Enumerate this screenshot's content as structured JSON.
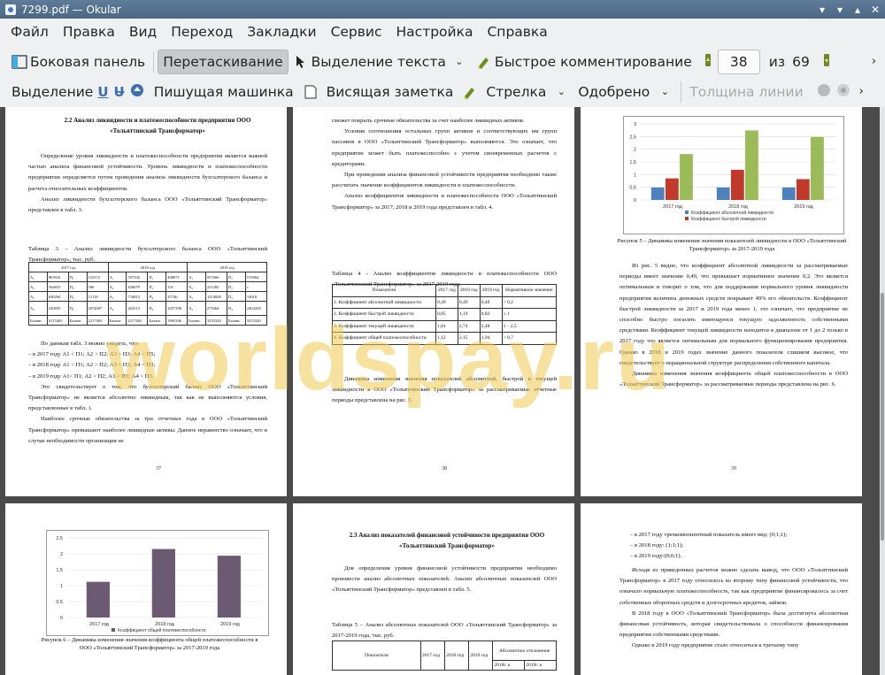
{
  "window": {
    "title": "7299.pdf  — Okular"
  },
  "menu": [
    "Файл",
    "Правка",
    "Вид",
    "Переход",
    "Закладки",
    "Сервис",
    "Настройка",
    "Справка"
  ],
  "toolbar1": {
    "sidebar": "Боковая панель",
    "drag": "Перетаскивание",
    "text_select": "Выделение текста",
    "quick_comment": "Быстрое комментирование",
    "page_current": "38",
    "of": "из",
    "page_total": "69"
  },
  "toolbar2": {
    "select": "Выделение",
    "typewriter": "Пишущая машинка",
    "note": "Висящая заметка",
    "arrow": "Стрелка",
    "stamp": "Одобрено",
    "line_width": "Толщина линии"
  },
  "watermark": "worldspay.ru",
  "p37": {
    "heading": "2.2 Анализ ликвидности и платежеспособности предприятия ООО «Тольяттинский Трансформатор»",
    "para1": "Определение уровня ликвидности и платежеспособности предприятия является важной частью анализа финансовой устойчивости. Уровень ликвидности и платежеспособности предприятия определяется путем проведения анализа ликвидности бухгалтерского баланса и расчета относительных коэффициентов.",
    "para2": "Анализ ликвидности бухгалтерского баланса ООО «Тольяттинский Трансформатор» представлен в табл. 3.",
    "table_caption": "Таблица 3 – Анализ ликвидности бухгалтерского баланса ООО «Тольяттинский Трансформатор», тыс. руб.",
    "years": [
      "2017 год",
      "2018 год",
      "2019 год"
    ],
    "rows": [
      [
        "А₁",
        "863916",
        "П₁",
        "125372",
        "А₁",
        "597556",
        "П₁",
        "408971",
        "А₁",
        "957606",
        "П₁",
        "576964"
      ],
      [
        "А₂",
        "564653",
        "П₂",
        "586",
        "А₂",
        "426079",
        "П₂",
        "331",
        "А₂",
        "231282",
        "П₂",
        "с"
      ],
      [
        "А₃",
        "648264",
        "П₃",
        "12118",
        "А₃",
        "734823",
        "П₃",
        "25746",
        "А₃",
        "1214828",
        "П₃",
        "14618"
      ],
      [
        "А₄",
        "249059",
        "П₄",
        "2074687",
        "А₄",
        "262513",
        "П₄",
        "2057298",
        "А₄",
        "279364",
        "П₄",
        "2464358"
      ],
      [
        "Баланс",
        "4115463",
        "Баланс",
        "2217463",
        "Баланс",
        "2217463",
        "Баланс",
        "3965346",
        "Баланс",
        "3253320",
        "Баланс",
        "3253320"
      ]
    ],
    "para3": "По данным табл. 3 можно увидеть, что:",
    "bullets": [
      "в 2017 году А1 < П1; А2 > П2; А3 > П3; А4 < П5;",
      "в 2018 году А1 < П1; А2 > П2; А3 > П3; А4 < П3;",
      "в 2019 году А1< П1; А2 > П2; А3 > П3; А4 < П3."
    ],
    "para4": "Это свидетельствует о том, что бухгалтерский баланс ООО «Тольяттинский Трансформатор» не является абсолютно ликвидным, так как не выполняются условия, представленные в табл. 1.",
    "para5": "Наиболее срочные обязательства за три отчетных года в ООО «Тольяттинский Трансформатор» превышают наиболее ликвидные активы. Данное неравенство означает, что в случае необходимости организация не",
    "page_number": "37"
  },
  "p38": {
    "para1": "сможет покрыть срочные обязательства за счет наиболее ликвидных активов.",
    "para2": "Условия соотношения остальных групп активов и соответствующих им групп пассивов в ООО «Тольяттинский Трансформатор» выполняются. Это означает, что предприятие может быть платежеспособно с учетом своевременных расчетов с кредиторами.",
    "para3": "При проведении анализа финансовой устойчивости предприятия необходимо также рассчитать значение коэффициентов ликвидности и платежеспособности.",
    "para4": "Анализ коэффициентов ликвидности и платежеспособности ООО «Тольяттинский Трансформатор» за 2017, 2018 и 2019 года представлен в табл. 4.",
    "table_caption": "Таблица 4 - Анализ коэффициентов ликвидности и платежеспособности ООО «Тольяттинский Трансформатор» за 2017-2019 года",
    "headers": [
      "Показатели",
      "2017 год",
      "2018 год",
      "2019 год",
      "Нормативное значение"
    ],
    "rows": [
      [
        "1. Коэффициент абсолютной ликвидности",
        "0,49",
        "0,49",
        "0,49",
        "> 0,2"
      ],
      [
        "2. Коэффициент быстрой ликвидности",
        "0,85",
        "1,19",
        "0,82",
        "≥ 1"
      ],
      [
        "3. Коэффициент текущей ликвидности",
        "1,81",
        "2,74",
        "2,48",
        "1 – 2,5"
      ],
      [
        "4. Коэффициент общей платежеспособности",
        "1,12",
        "2,15",
        "1,94",
        "> 0,7"
      ]
    ],
    "para5": "Динамика изменения значения показателей абсолютной, быстрой и текущей ликвидности в ООО «Тольяттинский Трансформатор» за рассматриваемые отчетные периоды представлена на рис. 5.",
    "page_number": "38"
  },
  "p39": {
    "chart_data": {
      "type": "bar",
      "categories": [
        "2017 год",
        "2018 год",
        "2019 год"
      ],
      "series": [
        {
          "name": "Коэффициент абсолютной ликвидности",
          "values": [
            0.49,
            0.49,
            0.49
          ],
          "color": "#4f81bd"
        },
        {
          "name": "Коэффициент быстрой ликвидности",
          "values": [
            0.85,
            1.19,
            0.82
          ],
          "color": "#c0392b"
        },
        {
          "name": "",
          "values": [
            1.81,
            2.74,
            2.48
          ],
          "color": "#9bbb59"
        }
      ],
      "ylim": [
        0,
        3
      ],
      "yticks": [
        "0",
        "0,5",
        "1",
        "1,5",
        "2",
        "2,5",
        "3"
      ],
      "grid": true,
      "legend": "bottom"
    },
    "caption": "Рисунок 5 – Динамика изменения значения показателей ликвидности в ООО «Тольяттинский Трансформатор» за 2017-2019 года",
    "para1": "Из рис. 5 видно, что коэффициент абсолютной ликвидности за рассматриваемые периоды имеет значение 0,49, что превышает нормативное значение 0,2. Это является оптимальным и говорит о том, что для поддержания нормального уровня ликвидности предприятия величина денежных средств покрывает 49% его обязательств. Коэффициент быстрой ликвидности за 2017 и 2019 года менее 1, это означает, что предприятие не способно быстро погасить имеющуюся текущую задолженность собственными средствами. Коэффициент текущей ликвидности находится в диапазоне от 1 до 2 только в 2017 году что является оптимальным для нормального функционирования предприятия. Однако в 2018 и 2019 годах значение данного показателя слишком высокое, что свидетельствует о нерациональной структуре распределения собственного капитала.",
    "para2": "Динамика изменения значения коэффициента общей платежеспособности в ООО «Тольяттинский Трансформатор» за рассматриваемые периоды представлена на рис. 6.",
    "page_number": "39"
  },
  "p40": {
    "chart_data": {
      "type": "bar",
      "categories": [
        "2017 год",
        "2018 год",
        "2019 год"
      ],
      "series": [
        {
          "name": "Коэффициент общей платежеспособности",
          "values": [
            1.12,
            2.15,
            1.94
          ],
          "color": "#6b5a72"
        }
      ],
      "ylim": [
        0,
        2.5
      ],
      "yticks": [
        "0",
        "0,5",
        "1",
        "1,5",
        "2",
        "2,5"
      ],
      "grid": true,
      "legend": "bottom"
    },
    "caption": "Рисунок 6 – Динамика изменения значения коэффициента общей платежеспособности в ООО «Тольяттинский Трансформатор» за 2017-2019 года"
  },
  "p41": {
    "heading": "2.3 Анализ показателей финансовой устойчивости предприятия ООО «Тольяттинский Трансформатор»",
    "para1": "Для определения уровня финансовой устойчивости предприятия необходимо произвести анализ абсолютных показателей. Анализ абсолютных показателей ООО «Тольяттинский Трансформатор» представлен в табл. 5.",
    "table_caption": "Таблица 5 – Анализ абсолютных показателей ООО «Тольяттинский Трансформатор» за 2017-2019 года, тыс. руб.",
    "headers": [
      "Показатели",
      "2017 год",
      "2018 год",
      "2019 год",
      "Абсолютное отклонение",
      "2018г. к",
      "2019г. к"
    ]
  },
  "p42": {
    "bullets": [
      "в 2017 году трехкомпонентный показатель имеет вид: (0;1;1);",
      "в 2018 году: (1;1;1);",
      "в 2019 году:(0;0;1)."
    ],
    "para1": "Исходя из приведенных расчетов можно сделать вывод, что ООО «Тольяттинский Трансформатор» в 2017 году относилось ко второму типу финансовой устойчивости, что означало нормальную платежеспособность, так как предприятие финансировалось за счет собственных оборотных средств и долгосрочных кредитов, займов.",
    "para2": "В 2018 году в ООО «Тольяттинский Трансформатор» была достигнута абсолютная финансовая устойчивость, которая свидетельствовала о способности финансирования предприятия собственными средствами.",
    "para3": "Однако в 2019 году предприятие стало относиться к третьему типу"
  }
}
